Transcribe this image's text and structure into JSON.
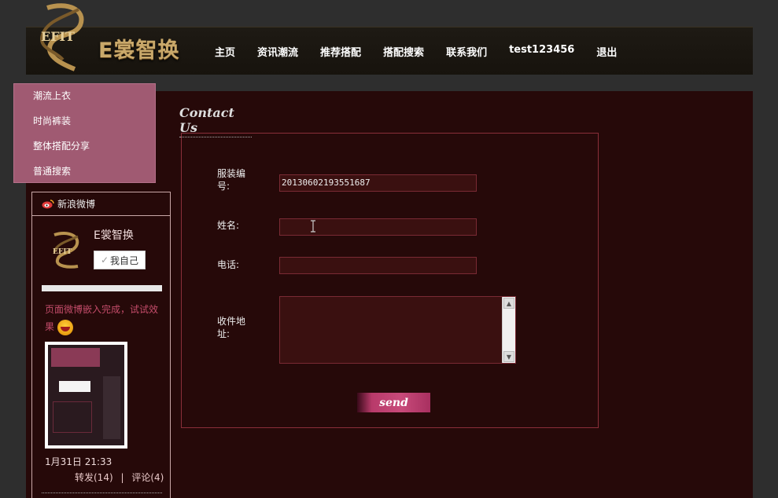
{
  "header": {
    "logo_text": "E裳智换",
    "logo_emblem_text": "EFIT"
  },
  "nav": {
    "items": [
      {
        "label": "主页"
      },
      {
        "label": "资讯潮流"
      },
      {
        "label": "推荐搭配"
      },
      {
        "label": "搭配搜索"
      },
      {
        "label": "联系我们"
      },
      {
        "label": "test123456"
      },
      {
        "label": "退出"
      }
    ]
  },
  "dropdown": {
    "items": [
      {
        "label": "潮流上衣"
      },
      {
        "label": "时尚裤装"
      },
      {
        "label": "整体搭配分享"
      },
      {
        "label": "普通搜索"
      }
    ]
  },
  "weibo": {
    "title": "新浪微博",
    "user_name": "E裳智换",
    "follow_label": "我自己",
    "post_text": "页面微博嵌入完成，试试效果",
    "time": "1月31日 21:33",
    "repost": "转发(14)",
    "separator": "|",
    "comment": "评论(4)"
  },
  "contact": {
    "title": "Contact Us",
    "fields": {
      "code_label": "服装编号:",
      "code_value": "20130602193551687",
      "name_label": "姓名:",
      "name_value": "",
      "phone_label": "电话:",
      "phone_value": "",
      "address_label": "收件地址:",
      "address_value": ""
    },
    "send_label": "send"
  },
  "colors": {
    "background": "#2e2e2e",
    "panel": "#260909",
    "menu": "#a05a72",
    "border": "#8a2f3a",
    "accent": "#c84a7a",
    "logo_gold": "#c9a86a"
  }
}
